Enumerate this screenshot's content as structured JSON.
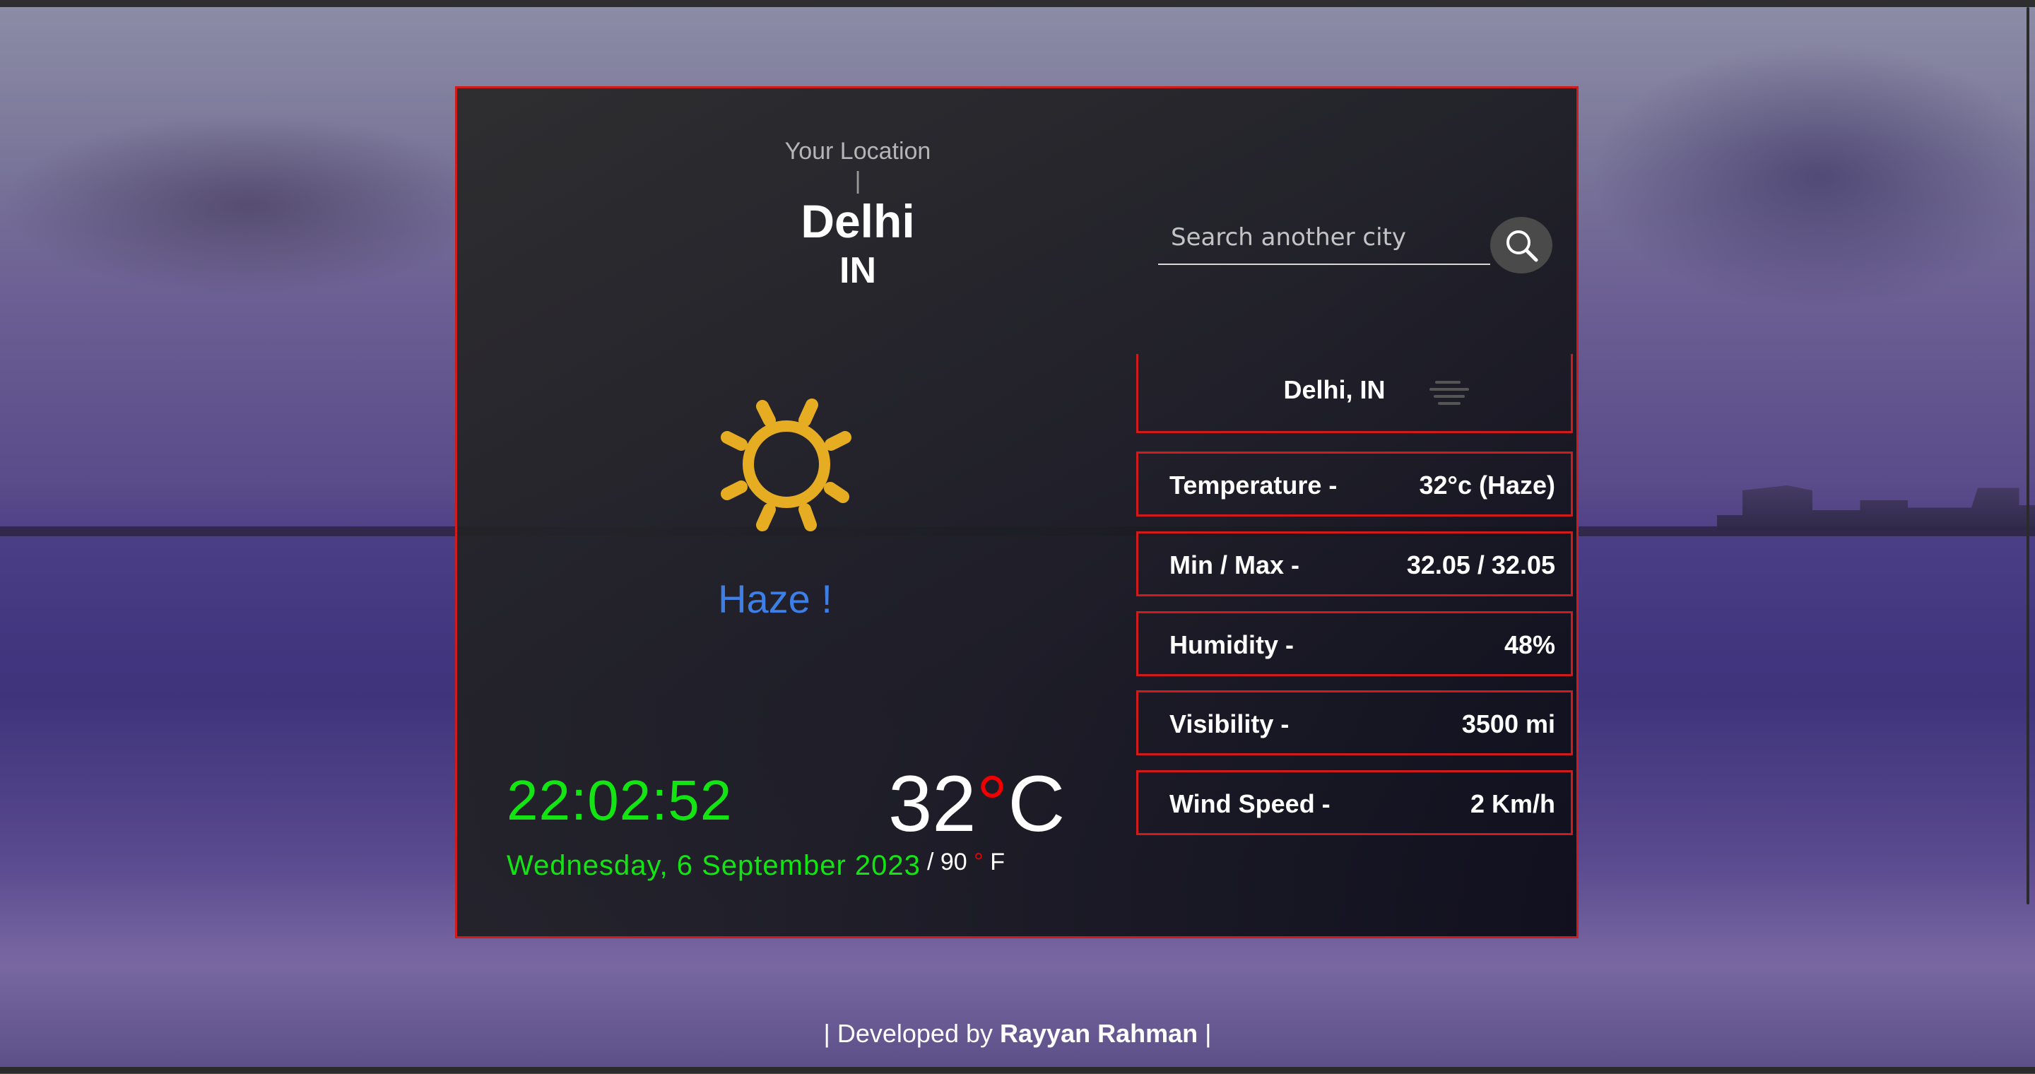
{
  "location": {
    "label": "Your Location",
    "separator": "|",
    "city": "Delhi",
    "country": "IN"
  },
  "weather": {
    "icon": "sun-icon",
    "condition": "Haze !"
  },
  "clock": {
    "time": "22:02:52",
    "date": "Wednesday, 6 September 2023"
  },
  "temperature": {
    "celsius": "32",
    "celsius_unit": "C",
    "fahrenheit_prefix": "/ 90",
    "fahrenheit_unit": "F",
    "degree": "°"
  },
  "search": {
    "placeholder": "Search another city",
    "button_icon": "search-icon"
  },
  "details": {
    "header": "Delhi, IN",
    "header_icon": "haze-icon",
    "rows": [
      {
        "label": "Temperature -",
        "value": "32°c (Haze)"
      },
      {
        "label": "Min / Max -",
        "value": "32.05 / 32.05"
      },
      {
        "label": "Humidity -",
        "value": "48%"
      },
      {
        "label": "Visibility -",
        "value": "3500 mi"
      },
      {
        "label": "Wind Speed -",
        "value": "2 Km/h"
      }
    ]
  },
  "footer": {
    "prefix": "| Developed by ",
    "author": "Rayyan Rahman",
    "suffix": " |"
  },
  "colors": {
    "border": "#d11a1a",
    "clock": "#13e513",
    "condition": "#3d7fe6",
    "sun": "#e6ad22"
  }
}
